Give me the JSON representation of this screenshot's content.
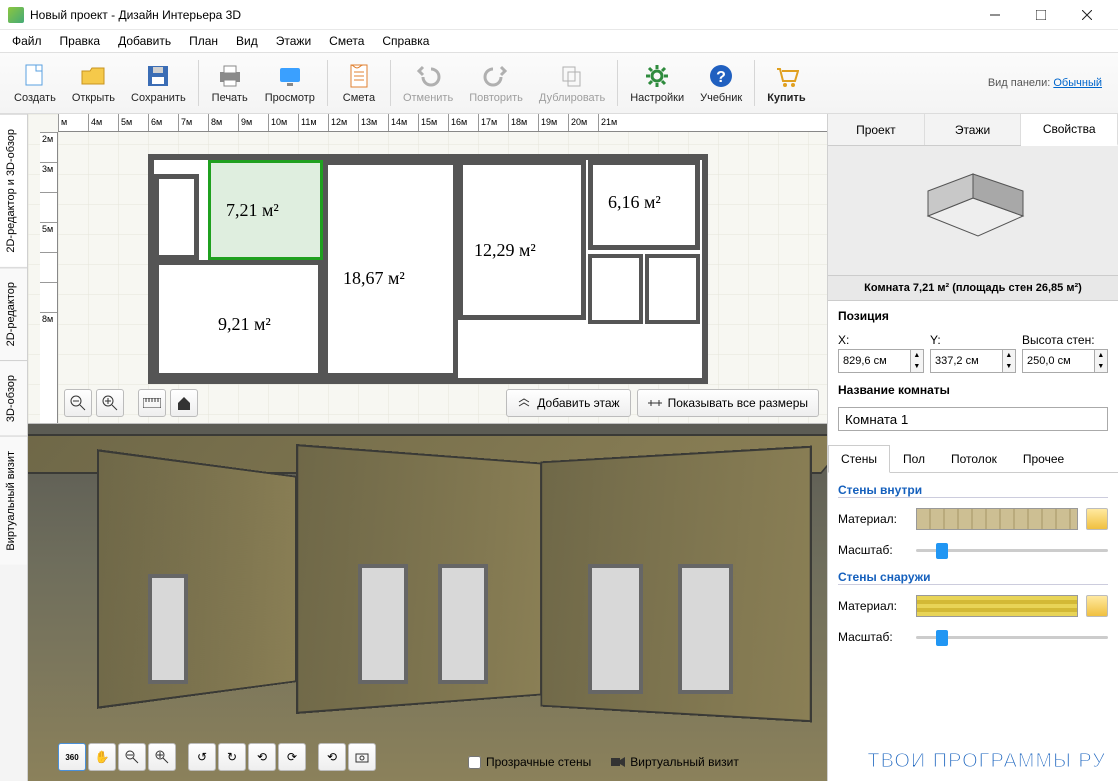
{
  "title": "Новый проект - Дизайн Интерьера 3D",
  "menu": [
    "Файл",
    "Правка",
    "Добавить",
    "План",
    "Вид",
    "Этажи",
    "Смета",
    "Справка"
  ],
  "toolbar": {
    "create": "Создать",
    "open": "Открыть",
    "save": "Сохранить",
    "print": "Печать",
    "preview": "Просмотр",
    "estimate": "Смета",
    "undo": "Отменить",
    "redo": "Повторить",
    "duplicate": "Дублировать",
    "settings": "Настройки",
    "tutorial": "Учебник",
    "buy": "Купить"
  },
  "panel_mode_label": "Вид панели:",
  "panel_mode_value": "Обычный",
  "side_tabs": [
    "2D-редактор и 3D-обзор",
    "2D-редактор",
    "3D-обзор",
    "Виртуальный визит"
  ],
  "ruler_h": [
    "м",
    "4м",
    "5м",
    "6м",
    "7м",
    "8м",
    "9м",
    "10м",
    "11м",
    "12м",
    "13м",
    "14м",
    "15м",
    "16м",
    "17м",
    "18м",
    "19м",
    "20м",
    "21м"
  ],
  "ruler_v": [
    "2м",
    "3м",
    "",
    "5м",
    "",
    "",
    "8м"
  ],
  "rooms": {
    "r1": "7,21 м²",
    "r2": "6,16 м²",
    "r3": "12,29 м²",
    "r4": "18,67 м²",
    "r5": "9,21 м²"
  },
  "plan_btn_add": "Добавить этаж",
  "plan_btn_dims": "Показывать все размеры",
  "view3d_transparent": "Прозрачные стены",
  "view3d_tour": "Виртуальный визит",
  "right_tabs": [
    "Проект",
    "Этажи",
    "Свойства"
  ],
  "info_line": "Комната 7,21 м²  (площадь стен 26,85 м²)",
  "pos_header": "Позиция",
  "pos_x_label": "X:",
  "pos_y_label": "Y:",
  "pos_h_label": "Высота стен:",
  "pos_x": "829,6 см",
  "pos_y": "337,2 см",
  "pos_h": "250,0 см",
  "room_name_label": "Название комнаты",
  "room_name": "Комната 1",
  "subtabs": [
    "Стены",
    "Пол",
    "Потолок",
    "Прочее"
  ],
  "grp_in": "Стены внутри",
  "grp_out": "Стены снаружи",
  "lbl_material": "Материал:",
  "lbl_scale": "Масштаб:",
  "watermark": "ТВОИ ПРОГРАММЫ РУ"
}
